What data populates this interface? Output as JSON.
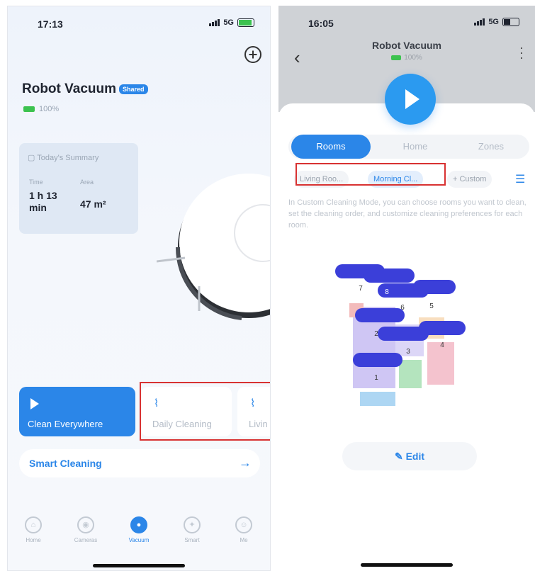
{
  "left_screen": {
    "status": {
      "time": "17:13",
      "network": "5G"
    },
    "device_title": "Robot Vacuum",
    "shared_badge": "Shared",
    "battery": "100%",
    "summary": {
      "title": "Today's Summary",
      "time_label": "Time",
      "time_value": "1 h 13 min",
      "area_label": "Area",
      "area_value": "47 m²"
    },
    "clean_button_label": "Clean Everywhere",
    "mode_cards": [
      {
        "label": "Daily Cleaning"
      },
      {
        "label": "Livin"
      }
    ],
    "smart_cleaning_label": "Smart Cleaning",
    "tabs": [
      {
        "label": "Home",
        "icon": "home-icon"
      },
      {
        "label": "Cameras",
        "icon": "camera-icon"
      },
      {
        "label": "Vacuum",
        "icon": "vacuum-icon",
        "active": true
      },
      {
        "label": "Smart",
        "icon": "smart-icon"
      },
      {
        "label": "Me",
        "icon": "person-icon"
      }
    ]
  },
  "right_screen": {
    "status": {
      "time": "16:05",
      "network": "5G"
    },
    "title": "Robot Vacuum",
    "battery": "100%",
    "segments": [
      "Rooms",
      "Home",
      "Zones"
    ],
    "chips": [
      "Living Roo...",
      "Morning Cl...",
      "+ Custom"
    ],
    "description": "In Custom Cleaning Mode, you can choose rooms you want to clean, set the cleaning order, and customize cleaning preferences for each room.",
    "room_numbers": [
      "1",
      "2",
      "3",
      "4",
      "5",
      "6",
      "7",
      "8"
    ],
    "edit_label": "Edit"
  },
  "colors": {
    "accent": "#2b86e8",
    "highlight_box": "#d83232",
    "battery_green": "#3cc24f"
  }
}
